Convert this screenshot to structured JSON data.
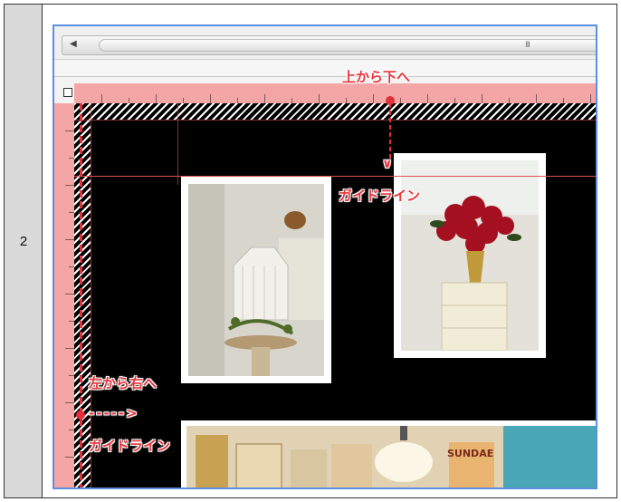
{
  "step": {
    "number": "2"
  },
  "guides": {
    "top_label": "上から下へ",
    "top_guide_label": "ガイドライン",
    "left_label": "左から右へ",
    "left_arrow": "----->",
    "left_guide_label": "ガイドライン"
  },
  "scrollbar": {
    "grip": "III",
    "left_arrow": "◀"
  },
  "photos": {
    "poster_text": "SUNDAE"
  },
  "colors": {
    "ruler": "#f4a5a5",
    "guide": "#e0504e",
    "label": "#e8333b",
    "frame": "#5b8fe0",
    "canvas": "#000000"
  }
}
